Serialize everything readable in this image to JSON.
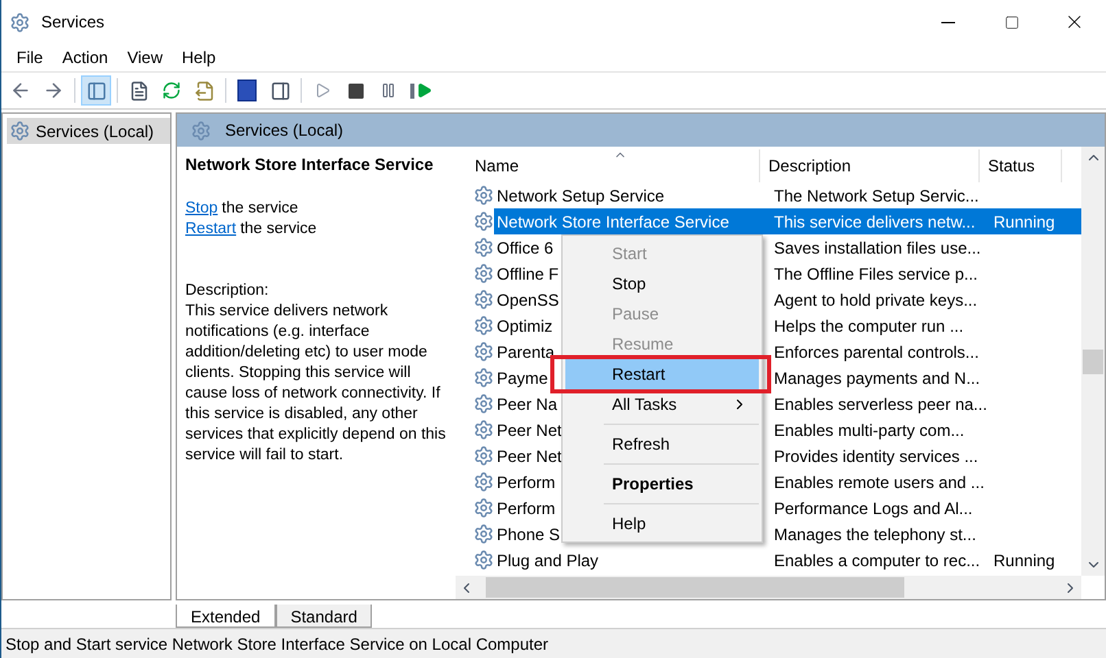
{
  "window": {
    "title": "Services"
  },
  "menu_bar": [
    "File",
    "Action",
    "View",
    "Help"
  ],
  "tree": {
    "items": [
      {
        "label": "Services (Local)",
        "selected": true
      }
    ]
  },
  "panel_header": "Services (Local)",
  "details": {
    "title": "Network Store Interface Service",
    "actions": [
      {
        "link": "Stop",
        "text": "the service"
      },
      {
        "link": "Restart",
        "text": "the service"
      }
    ],
    "description_label": "Description:",
    "description": "This service delivers network notifications (e.g. interface addition/deleting etc) to user mode clients. Stopping this service will cause loss of network connectivity. If this service is disabled, any other services that explicitly depend on this service will fail to start."
  },
  "table": {
    "columns": [
      "Name",
      "Description",
      "Status"
    ],
    "rows": [
      {
        "name": "Network Setup Service",
        "description": "The Network Setup Servic...",
        "selected": false
      },
      {
        "name": "Network Store Interface Service",
        "description": "This service delivers netw...",
        "status": "Running",
        "selected": true
      },
      {
        "name": "Office 6",
        "description": "Saves installation files use...",
        "selected": false
      },
      {
        "name": "Offline F",
        "description": "The Offline Files service p...",
        "selected": false
      },
      {
        "name": "OpenSS",
        "description": "Agent to hold private keys...",
        "selected": false
      },
      {
        "name": "Optimiz",
        "description": "Helps the computer run ...",
        "selected": false
      },
      {
        "name": "Parenta",
        "description": "Enforces parental controls...",
        "selected": false
      },
      {
        "name": "Payme",
        "description": "Manages payments and N...",
        "selected": false
      },
      {
        "name": "Peer Na",
        "description": "Enables serverless peer na...",
        "selected": false
      },
      {
        "name": "Peer Net",
        "description": "Enables multi-party com...",
        "selected": false
      },
      {
        "name": "Peer Net",
        "description": "Provides identity services ...",
        "selected": false
      },
      {
        "name": "Perform",
        "description": "Enables remote users and ...",
        "selected": false
      },
      {
        "name": "Perform",
        "description": "Performance Logs and Al...",
        "selected": false
      },
      {
        "name": "Phone S",
        "description": "Manages the telephony st...",
        "selected": false
      },
      {
        "name": "Plug and Play",
        "description": "Enables a computer to rec...",
        "status": "Running",
        "selected": false
      }
    ]
  },
  "context_menu": [
    {
      "kind": "item",
      "label": "Start",
      "disabled": true,
      "selected": false,
      "bold": false,
      "annotated": false
    },
    {
      "kind": "item",
      "label": "Stop",
      "disabled": false,
      "selected": false,
      "bold": false,
      "annotated": false
    },
    {
      "kind": "item",
      "label": "Pause",
      "disabled": true,
      "selected": false,
      "bold": false,
      "annotated": false
    },
    {
      "kind": "item",
      "label": "Resume",
      "disabled": true,
      "selected": false,
      "bold": false,
      "annotated": false
    },
    {
      "kind": "item",
      "label": "Restart",
      "disabled": false,
      "selected": true,
      "bold": false,
      "annotated": true
    },
    {
      "kind": "submenu",
      "label": "All Tasks",
      "disabled": false,
      "selected": false,
      "bold": false,
      "annotated": false
    },
    {
      "kind": "separator"
    },
    {
      "kind": "item",
      "label": "Refresh",
      "disabled": false,
      "selected": false,
      "bold": false,
      "annotated": false
    },
    {
      "kind": "separator"
    },
    {
      "kind": "item",
      "label": "Properties",
      "disabled": false,
      "selected": false,
      "bold": true,
      "annotated": false
    },
    {
      "kind": "separator"
    },
    {
      "kind": "item",
      "label": "Help",
      "disabled": false,
      "selected": false,
      "bold": false,
      "annotated": false
    }
  ],
  "view_tabs": [
    {
      "label": "Extended",
      "selected": true
    },
    {
      "label": "Standard",
      "selected": false
    }
  ],
  "status_bar": "Stop and Start service Network Store Interface Service on Local Computer"
}
